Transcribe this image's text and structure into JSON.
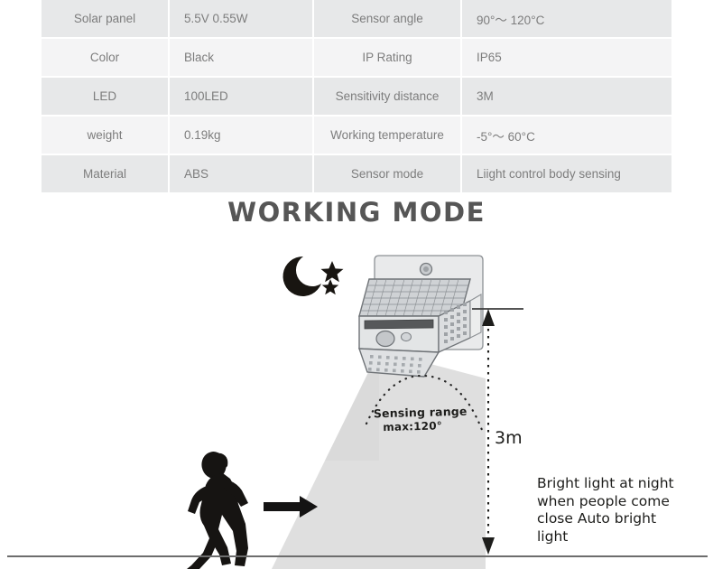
{
  "spec_table": {
    "rows": [
      {
        "label_left": "Solar panel",
        "value_left": "5.5V  0.55W",
        "label_right": "Sensor angle",
        "value_right": "90°〜 120°C"
      },
      {
        "label_left": "Color",
        "value_left": "Black",
        "label_right": "IP Rating",
        "value_right": "IP65"
      },
      {
        "label_left": "LED",
        "value_left": "100LED",
        "label_right": "Sensitivity distance",
        "value_right": "3M"
      },
      {
        "label_left": "weight",
        "value_left": "0.19kg",
        "label_right": "Working temperature",
        "value_right": "-5°〜 60°C"
      },
      {
        "label_left": "Material",
        "value_left": "ABS",
        "label_right": "Sensor mode",
        "value_right": "Liight control body sensing"
      }
    ],
    "colors": {
      "row_odd_bg": "#e7e8e9",
      "row_even_bg": "#f4f4f5",
      "label_text": "#6f6f70",
      "value_text": "#8e8e8f"
    }
  },
  "section": {
    "title": "WORKING MODE"
  },
  "illustration": {
    "sensing_label_line1": "Sensing range",
    "sensing_label_line2": "max:120°",
    "distance_label": "3m",
    "description": "Bright light at night when people come close Auto bright light",
    "icons": {
      "moon": "crescent-moon-icon",
      "stars": "star-icon",
      "lamp": "solar-wall-lamp-icon",
      "person": "running-person-icon",
      "arrow": "right-arrow-icon",
      "measure": "vertical-dimension-arrow-icon",
      "beam": "light-beam-cone",
      "ground": "ground-line"
    },
    "colors": {
      "beam_fill": "#dcdcdc",
      "silhouette": "#161412",
      "ground_line": "#6d6d6d",
      "lamp_body": "#d8d9da"
    }
  }
}
